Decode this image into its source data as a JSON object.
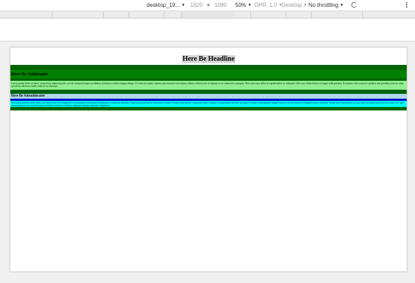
{
  "toolbar": {
    "device": "desktop_19...",
    "width": "1920",
    "times": "×",
    "height": "1080",
    "zoom": "50%",
    "dpr": "DPR: 1.0",
    "mode": "Desktop",
    "throttling": "No throttling"
  },
  "page": {
    "headline": "Here Be Headline",
    "subheader": "Here Be Subheader",
    "paragraph1": "Lorem ipsum dolor sit amet, consectetur adipiscing elit, sed do eiusmod tempor incididunt ut labore et dolore magna aliqua. Ut enim ad minim veniam, quis nostrud exercitation ullamco laboris nisi ut aliquip ex ea commodo consequat. Duis aute irure dolor in reprehenderit in voluptate velit esse cillum dolore eu fugiat nulla pariatur. Excepteur sint occaecat cupidatat non proident, sunt in culpa qui officia deserunt mollit anim id est laborum.",
    "subsubheader": "Here Be Subsubheader",
    "paragraph2": "Sed ut perspiciatis unde omnis iste natus error sit voluptatem accusantium doloremque laudantium, totam rem aperiam, eaque ipsa quae ab illo inventore veritatis. Nemo enim ipsam voluptatem quia voluptas sit aspernatur aut odit aut fugit, sed quia consequuntur magni dolores eos qui ratione voluptatem sequi nesciunt. Neque porro quisquam est, qui dolorem ipsum quia dolor sit amet, sed quia non numquam eius modi tempora incidunt ut labore et dolore magnam aliquam quaerat voluptatem."
  }
}
